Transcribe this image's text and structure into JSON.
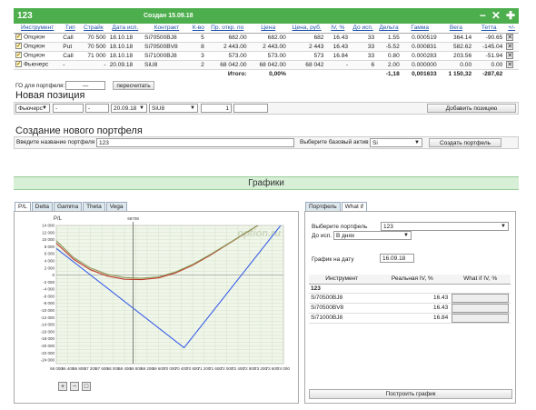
{
  "portfolio": {
    "name": "123",
    "created": "Создан 15.09.18",
    "icons": [
      "minus-icon",
      "close-icon",
      "plus-icon"
    ],
    "columns": [
      "Инструмент",
      "Тип",
      "Страйк",
      "Дата исп.",
      "Контракт",
      "К-во",
      "Пр. откр. по",
      "Цена",
      "Цена, руб.",
      "IV, %",
      "До исп.",
      "Дельта",
      "Гамма",
      "Вега",
      "Тетта",
      "+/-"
    ],
    "rows": [
      [
        "Опцион",
        "Call",
        "70 500",
        "18.10.18",
        "Si70500BJ8",
        "5",
        "682.00",
        "682.00",
        "682",
        "16.43",
        "33",
        "1.55",
        "0.000519",
        "364.14",
        "-90.65"
      ],
      [
        "Опцион",
        "Put",
        "70 500",
        "18.10.18",
        "Si70500BV8",
        "8",
        "2 443.00",
        "2 443.00",
        "2 443",
        "16.43",
        "33",
        "-5.52",
        "0.000831",
        "582.62",
        "-145.04"
      ],
      [
        "Опцион",
        "Call",
        "71 000",
        "18.10.18",
        "Si71000BJ8",
        "3",
        "573.00",
        "573.00",
        "573",
        "16.84",
        "33",
        "0.80",
        "0.000283",
        "203.56",
        "-51.94"
      ],
      [
        "Фьючерс",
        "-",
        "-",
        "20.09.18",
        "SiU8",
        "2",
        "68 042.00",
        "68 042.00",
        "68 042",
        "-",
        "6",
        "2.00",
        "0.000000",
        "0.00",
        "0.00"
      ]
    ],
    "total_label": "Итого:",
    "total_pct": "0,00%",
    "totals": [
      "-1,18",
      "0,001633",
      "1 150,32",
      "-287,62"
    ]
  },
  "go": {
    "label": "ГО для портфеля:",
    "value": "—",
    "button": "пересчитать"
  },
  "new_position": {
    "title": "Новая позиция",
    "type": "Фьючерс",
    "field2": "-",
    "field3": "-",
    "date": "20.09.18",
    "contract": "SiU8",
    "qty": "1",
    "add_button": "Добавить позицию"
  },
  "create_portfolio": {
    "title": "Создание нового портфеля",
    "name_label": "Введите название портфеля",
    "name_value": "123",
    "asset_label": "Выберите базовый актив",
    "asset_value": "Si",
    "create_button": "Создать портфель"
  },
  "charts": {
    "header": "Графики",
    "tabs": [
      "P/L",
      "Delta",
      "Gamma",
      "Theta",
      "Vega"
    ],
    "active_tab": "P/L",
    "watermark": "option.ru",
    "zoom_icons": [
      "zoom-in-icon",
      "zoom-out-icon",
      "zoom-reset-icon"
    ]
  },
  "chart_data": {
    "type": "line",
    "ylabel": "P/L",
    "marker_label": "68708",
    "marker_x": 68708,
    "xlim": [
      66000,
      72000
    ],
    "ylim": [
      -25000,
      14000
    ],
    "x_ticks": [
      "66 000",
      "66 400",
      "66 800",
      "67 200",
      "67 600",
      "68 000",
      "68 400",
      "68 800",
      "69 200",
      "69 600",
      "70 000",
      "70 400",
      "70 800",
      "71 200",
      "71 600",
      "72 000",
      "72 400",
      "72 800",
      "73 200",
      "73 600",
      "74 000"
    ],
    "y_ticks": [
      "14 000",
      "13 000",
      "12 000",
      "11 000",
      "10 000",
      "9 000",
      "8 000",
      "7 000",
      "6 000",
      "5 000",
      "4 000",
      "3 000",
      "2 000",
      "1 000",
      "0",
      "-1 000",
      "-2 000",
      "-3 000",
      "-4 000",
      "-5 000",
      "-6 000",
      "-7 000",
      "-8 000",
      "-9 000",
      "-10 000",
      "-11 000",
      "-12 000",
      "-13 000",
      "-14 000",
      "-15 000",
      "-16 000",
      "-17 000",
      "-18 000",
      "-19 000",
      "-20 000",
      "-21 000",
      "-22 000",
      "-23 000",
      "-24 000",
      "-25 000"
    ],
    "series": [
      {
        "color": "#3a5ee8",
        "x": [
          66000,
          70500,
          74000
        ],
        "y": [
          7500,
          -20500,
          15000
        ]
      },
      {
        "color": "#c0392b",
        "x": [
          66000,
          66600,
          67200,
          67800,
          68400,
          69000,
          69600,
          70200,
          70800,
          71400,
          72000,
          72600,
          73200,
          73800
        ],
        "y": [
          9000,
          4500,
          1500,
          -300,
          -1200,
          -1300,
          -800,
          600,
          2800,
          5500,
          8500,
          11500,
          14500,
          17000
        ]
      },
      {
        "color": "#8a9a5b",
        "x": [
          66000,
          66600,
          67200,
          67800,
          68400,
          69000,
          69600,
          70200,
          70800,
          71400,
          72000,
          72600,
          73200,
          73800
        ],
        "y": [
          9700,
          5000,
          2000,
          200,
          -700,
          -900,
          -500,
          900,
          3000,
          5700,
          8600,
          11600,
          14500,
          17000
        ]
      }
    ]
  },
  "whatif": {
    "tabs": [
      "Портфель",
      "What if"
    ],
    "active_tab": "What if",
    "portfolio_label": "Выберите портфель",
    "portfolio_value": "123",
    "until_label": "До исп.",
    "until_value": "В днях",
    "date_label": "График на дату",
    "date_value": "16.09.18",
    "columns": [
      "Инструмент",
      "Реальная IV, %",
      "What if IV, %"
    ],
    "group": "123",
    "rows": [
      {
        "instrument": "Si70500BJ8",
        "iv": "16.43"
      },
      {
        "instrument": "Si70500BV8",
        "iv": "16.43"
      },
      {
        "instrument": "Si71000BJ8",
        "iv": "16.84"
      }
    ],
    "build_button": "Построить график"
  }
}
